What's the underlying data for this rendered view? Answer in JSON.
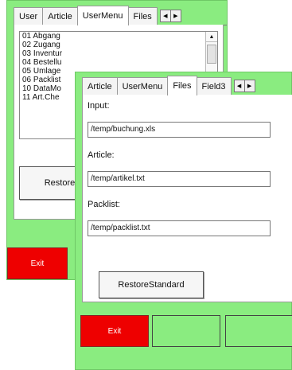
{
  "back_window": {
    "tabs": [
      "User",
      "Article",
      "UserMenu",
      "Files"
    ],
    "active_tab": "UserMenu",
    "menu_items": [
      "01 Abgang",
      "02 Zugang",
      "03 Inventur",
      "04 Bestellu",
      "05 Umlage",
      "06 Packlist",
      "10 DataMo",
      "11 Art.Che"
    ],
    "restore_label": "Restore",
    "exit_label": "Exit"
  },
  "front_window": {
    "tabs": [
      "Article",
      "UserMenu",
      "Files",
      "Field3"
    ],
    "active_tab": "Files",
    "input_label": "Input:",
    "input_value": "/temp/buchung.xls",
    "article_label": "Article:",
    "article_value": "/temp/artikel.txt",
    "packlist_label": "Packlist:",
    "packlist_value": "/temp/packlist.txt",
    "restore_label": "RestoreStandard",
    "exit_label": "Exit"
  },
  "colors": {
    "window_bg": "#8aec80",
    "exit_bg": "#ee0000"
  }
}
